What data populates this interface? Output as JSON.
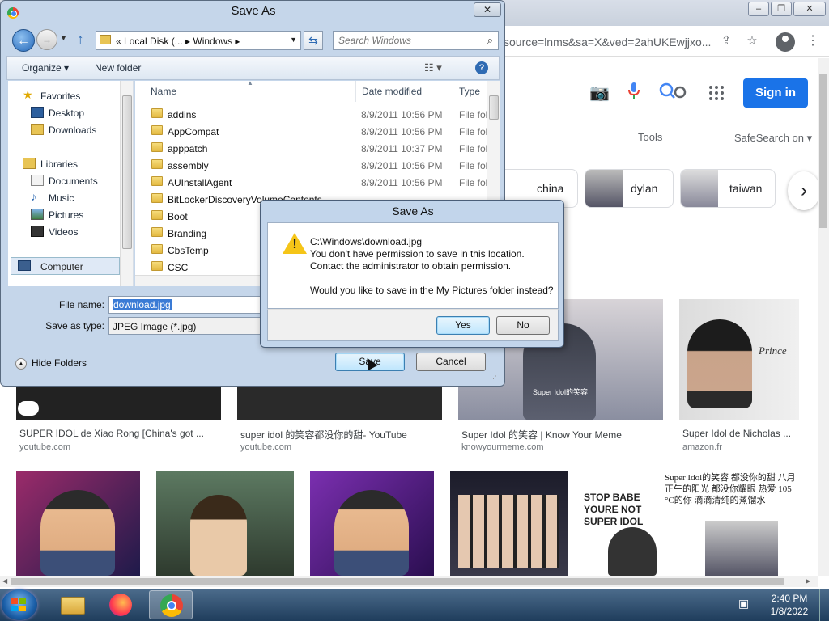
{
  "browser": {
    "url_fragment": "source=lnms&sa=X&ved=2ahUKEwjjxo...",
    "signin_label": "Sign in",
    "tools_label": "Tools",
    "safesearch_label": "SafeSearch on ▾",
    "chips": [
      {
        "label": "china"
      },
      {
        "label": "dylan"
      },
      {
        "label": "taiwan"
      }
    ],
    "results_row1": [
      {
        "caption": "SUPER IDOL de Xiao Rong [China's got ...",
        "source": "youtube.com"
      },
      {
        "caption": "super idol 的笑容都没你的甜- YouTube",
        "source": "youtube.com"
      },
      {
        "caption": "Super Idol 的笑容 | Know Your Meme",
        "source": "knowyourmeme.com"
      },
      {
        "caption": "Super Idol de Nicholas ...",
        "source": "amazon.fr"
      }
    ],
    "tile_texts": {
      "super_idol_wm": "Super Idol的笑容",
      "prince": "Prince",
      "stop_babe": "STOP BABE YOURE NOT SUPER IDOL",
      "chinese_lyric": "Super Idol的笑容 都没你的甜 八月正午的阳光 都没你耀眼 热爱 105 °C的你 滴滴清纯的蒸馏水"
    }
  },
  "taskbar": {
    "time": "2:40 PM",
    "date": "1/8/2022"
  },
  "save_dialog": {
    "title": "Save As",
    "path_crumbs": "«  Local Disk (...  ▸  Windows  ▸",
    "search_placeholder": "Search Windows",
    "organize_label": "Organize ▾",
    "new_folder_label": "New folder",
    "nav": {
      "favorites": "Favorites",
      "desktop": "Desktop",
      "downloads": "Downloads",
      "libraries": "Libraries",
      "documents": "Documents",
      "music": "Music",
      "pictures": "Pictures",
      "videos": "Videos",
      "computer": "Computer"
    },
    "columns": {
      "name": "Name",
      "date": "Date modified",
      "type": "Type"
    },
    "files": [
      {
        "name": "addins",
        "date": "8/9/2011 10:56 PM",
        "type": "File fol"
      },
      {
        "name": "AppCompat",
        "date": "8/9/2011 10:56 PM",
        "type": "File fol"
      },
      {
        "name": "apppatch",
        "date": "8/9/2011 10:37 PM",
        "type": "File fol"
      },
      {
        "name": "assembly",
        "date": "8/9/2011 10:56 PM",
        "type": "File fol"
      },
      {
        "name": "AUInstallAgent",
        "date": "8/9/2011 10:56 PM",
        "type": "File fol"
      },
      {
        "name": "BitLockerDiscoveryVolumeContents",
        "date": "",
        "type": ""
      },
      {
        "name": "Boot",
        "date": "",
        "type": ""
      },
      {
        "name": "Branding",
        "date": "",
        "type": ""
      },
      {
        "name": "CbsTemp",
        "date": "",
        "type": ""
      },
      {
        "name": "CSC",
        "date": "",
        "type": ""
      }
    ],
    "file_name_label": "File name:",
    "file_name_value": "download.jpg",
    "save_type_label": "Save as type:",
    "save_type_value": "JPEG Image (*.jpg)",
    "hide_folders_label": "Hide Folders",
    "save_label": "Save",
    "cancel_label": "Cancel"
  },
  "error_dialog": {
    "title": "Save As",
    "line1": "C:\\Windows\\download.jpg",
    "line2": "You don't have permission to save in this location.",
    "line3": "Contact the administrator to obtain permission.",
    "line4": "Would you like to save in the My Pictures folder instead?",
    "yes_label": "Yes",
    "no_label": "No"
  }
}
